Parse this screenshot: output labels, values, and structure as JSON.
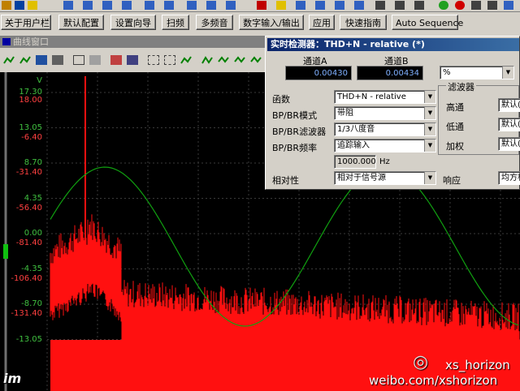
{
  "buttons": [
    "关于用户栏",
    "默认配置",
    "设置向导",
    "扫频",
    "多频音",
    "数字输入/输出",
    "应用",
    "快速指南",
    "Auto Sequence"
  ],
  "graph_window": {
    "title": "曲线窗口"
  },
  "plot": {
    "unit": "V",
    "labels_green": [
      "17.30",
      "13.05",
      "8.70",
      "4.35",
      "0.00",
      "-4.35",
      "-8.70",
      "-13.05"
    ],
    "labels_red": [
      "18.00",
      "-6.40",
      "-31.40",
      "-56.40",
      "-81.40",
      "-106.40",
      "-131.40"
    ]
  },
  "dialog": {
    "title": "实时检测器：THD+N - relative (*)",
    "channel_a_label": "通道A",
    "channel_b_label": "通道B",
    "channel_a_value": "0.00430",
    "channel_b_value": "0.00434",
    "unit": "%",
    "function_label": "函数",
    "function_value": "THD+N - relative",
    "bp_mode_label": "BP/BR模式",
    "bp_mode_value": "带阻",
    "bp_filter_label": "BP/BR滤波器",
    "bp_filter_value": "1/3八度音",
    "bp_freq_label": "BP/BR频率",
    "bp_freq_value": "追踪输入",
    "freq_value": "1000.000",
    "freq_unit": "Hz",
    "relative_label": "相对性",
    "relative_value": "相对于信号源",
    "filter_group": "滤波器",
    "highpass_label": "高通",
    "highpass_value": "默认(",
    "lowpass_label": "低通",
    "lowpass_value": "默认(",
    "weighting_label": "加权",
    "weighting_value": "默认(",
    "response_label": "响应",
    "response_value": "均方根"
  },
  "watermark": {
    "line1": "xs_horizon",
    "line2": "weibo.com/xshorizon",
    "logo": "im"
  }
}
